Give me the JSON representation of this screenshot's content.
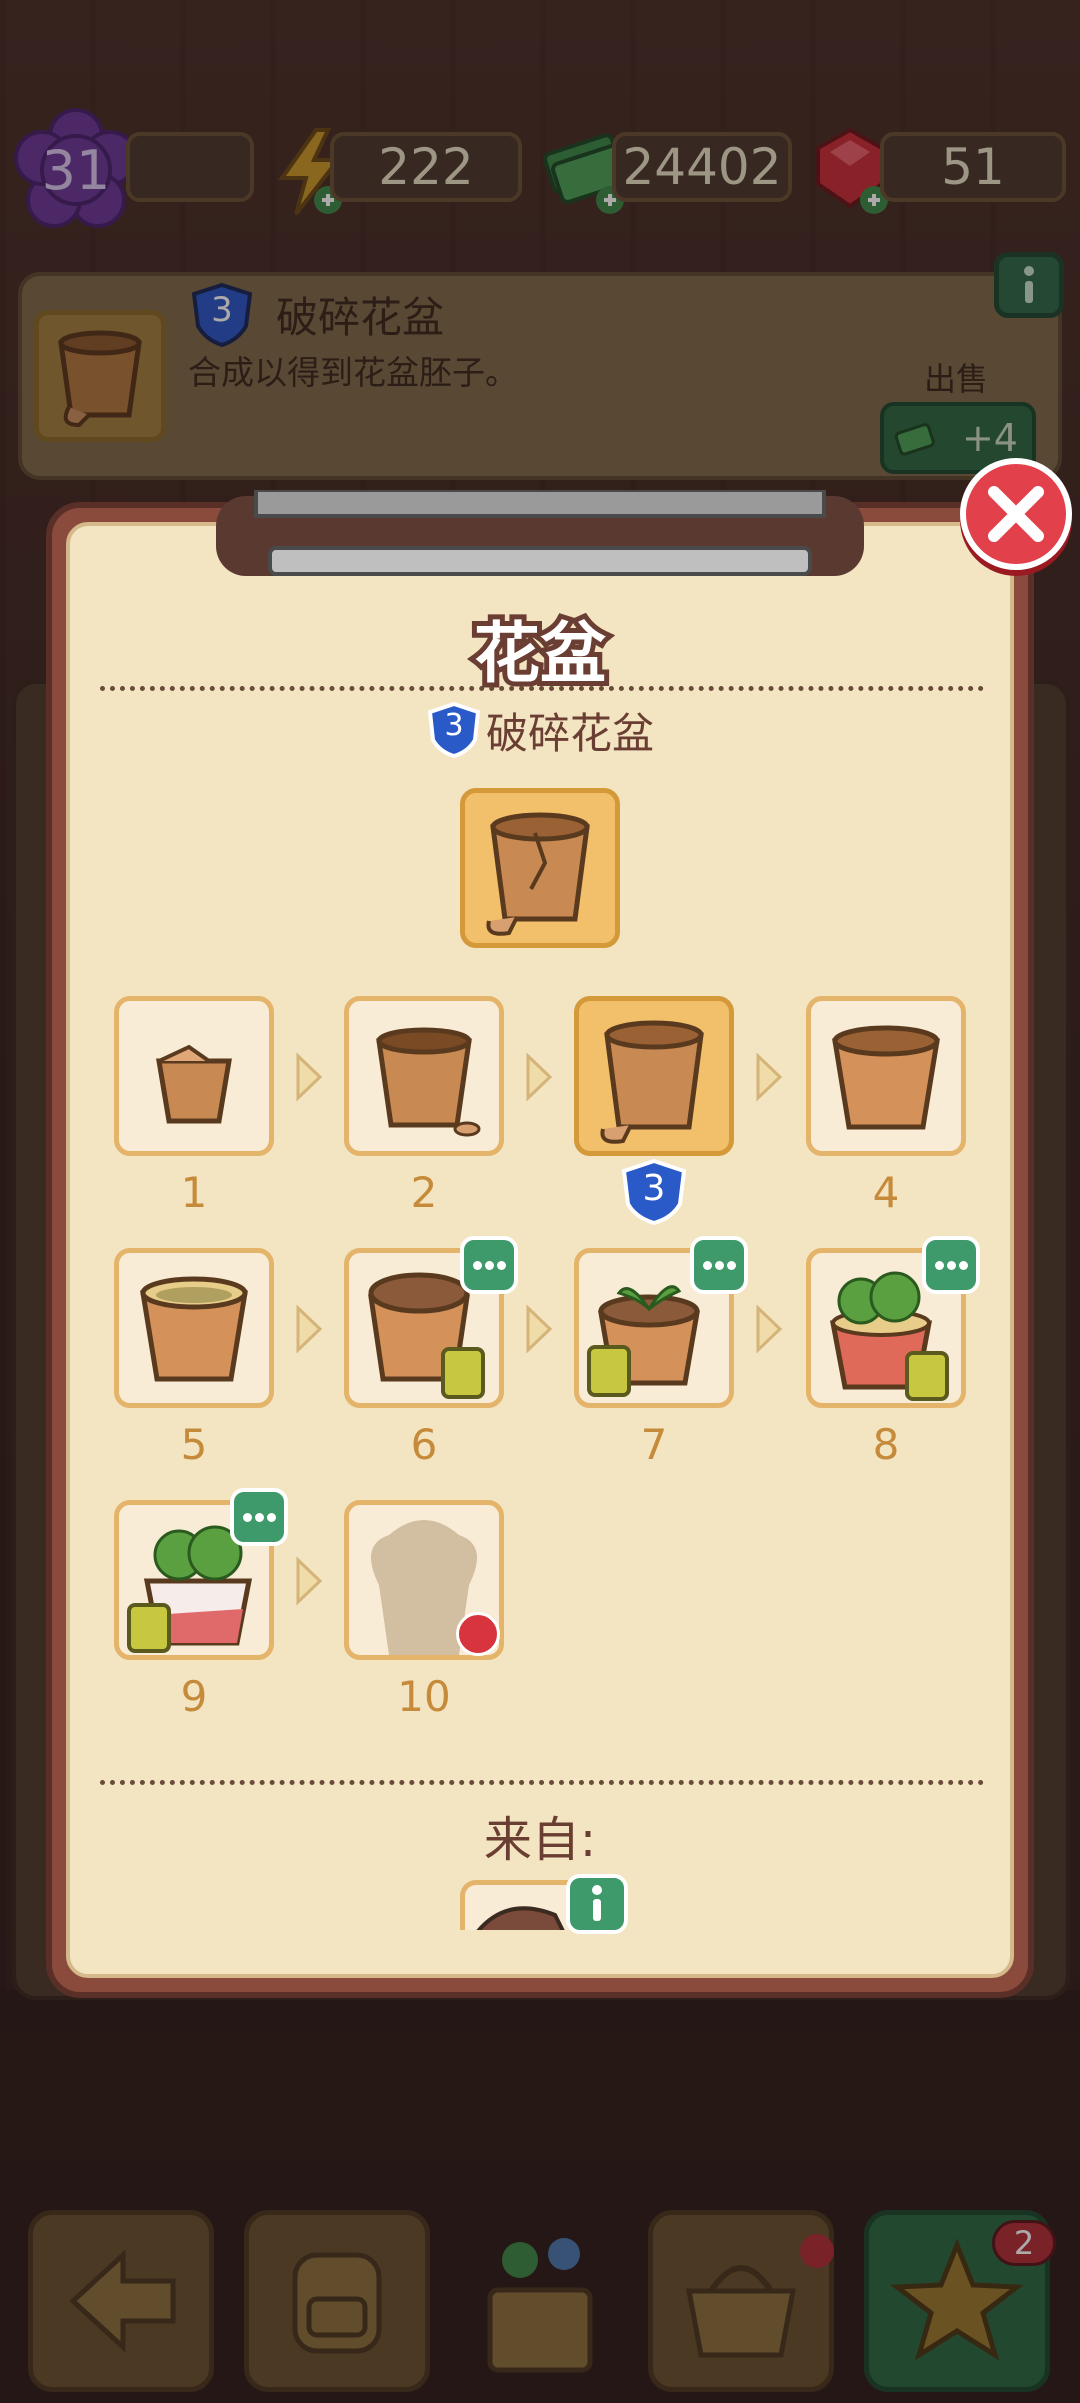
{
  "stats": {
    "level": "31",
    "energy": "222",
    "cash": "24402",
    "gems": "51"
  },
  "item_info": {
    "tier": "3",
    "name": "破碎花盆",
    "description": "合成以得到花盆胚子。",
    "sell_label": "出售",
    "sell_value": "+4"
  },
  "modal": {
    "title": "花盆",
    "current_tier": "3",
    "current_name": "破碎花盆",
    "chain": [
      {
        "level": "1",
        "has_more": false,
        "locked": false,
        "highlighted": false
      },
      {
        "level": "2",
        "has_more": false,
        "locked": false,
        "highlighted": false
      },
      {
        "level": "3",
        "has_more": false,
        "locked": false,
        "highlighted": true
      },
      {
        "level": "4",
        "has_more": false,
        "locked": false,
        "highlighted": false
      },
      {
        "level": "5",
        "has_more": false,
        "locked": false,
        "highlighted": false
      },
      {
        "level": "6",
        "has_more": true,
        "locked": false,
        "highlighted": false
      },
      {
        "level": "7",
        "has_more": true,
        "locked": false,
        "highlighted": false
      },
      {
        "level": "8",
        "has_more": true,
        "locked": false,
        "highlighted": false
      },
      {
        "level": "9",
        "has_more": true,
        "locked": false,
        "highlighted": false
      },
      {
        "level": "10",
        "has_more": false,
        "locked": true,
        "highlighted": false
      }
    ],
    "current_marker": "3",
    "from_label": "来自:"
  },
  "bottom_nav": {
    "achievements_badge": "2"
  },
  "colors": {
    "accent_green": "#3e9a6a",
    "close_red": "#e2404a",
    "shield_blue": "#2a5ac8",
    "number_orange": "#c58a3a"
  }
}
